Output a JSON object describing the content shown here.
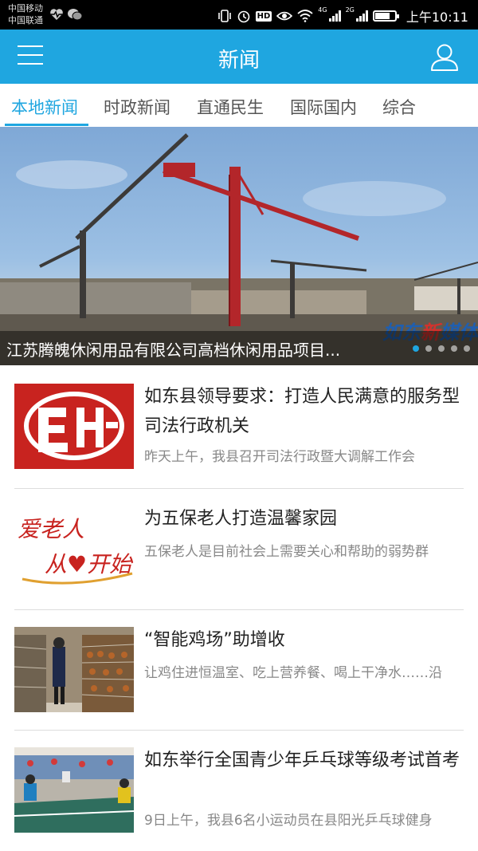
{
  "status_bar": {
    "carrier1": "中国移动",
    "carrier2": "中国联通",
    "network1": "4G",
    "network2": "2G",
    "hd": "HD",
    "time": "上午10:11",
    "battery_level": 0.75,
    "icons": [
      "heartbeat-icon",
      "wechat-icon",
      "vibrate-icon",
      "alarm-icon",
      "eye-icon",
      "wifi-icon",
      "signal-icon",
      "battery-icon"
    ]
  },
  "app_bar": {
    "title": "新闻",
    "background": "#1fa6e0",
    "icons": [
      "menu-icon",
      "user-icon"
    ]
  },
  "tabs": [
    {
      "label": "本地新闻",
      "active": true
    },
    {
      "label": "时政新闻",
      "active": false
    },
    {
      "label": "直通民生",
      "active": false
    },
    {
      "label": "国际国内",
      "active": false
    },
    {
      "label": "综合",
      "active": false
    }
  ],
  "banner": {
    "caption": "江苏腾魄休闲用品有限公司高档休闲用品项目...",
    "watermark_main": "如东",
    "watermark_accent": "新",
    "watermark_end": "媒体",
    "slide_count": 5,
    "active_slide": 1
  },
  "news": [
    {
      "title": "如东县领导要求：打造人民满意的服务型司法行政机关",
      "summary": "昨天上午，我县召开司法行政暨大调解工作会",
      "thumb": "justice-logo-image"
    },
    {
      "title": "为五保老人打造温馨家园",
      "summary": "五保老人是目前社会上需要关心和帮助的弱势群",
      "thumb": "care-for-elderly-banner-image",
      "thumb_text_1": "爱老人",
      "thumb_text_2": "从♥开始"
    },
    {
      "title": "“智能鸡场”助增收",
      "summary": "让鸡住进恒温室、吃上营养餐、喝上干净水……沿",
      "thumb": "chicken-farm-photo"
    },
    {
      "title": "如东举行全国青少年乒乓球等级考试首考",
      "summary": "9日上午，我县6名小运动员在县阳光乒乓球健身",
      "thumb": "table-tennis-photo"
    }
  ]
}
